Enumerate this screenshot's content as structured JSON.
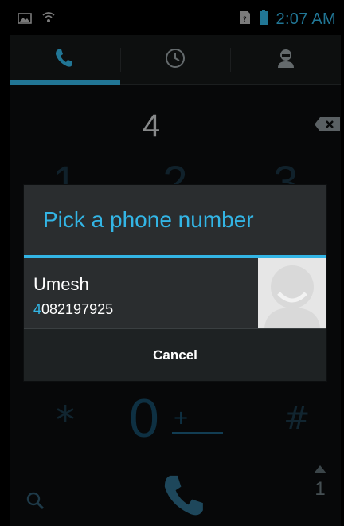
{
  "status_bar": {
    "time": "2:07 AM",
    "icons": [
      "image-notification-icon",
      "wifi-icon",
      "sim-icon",
      "battery-icon"
    ]
  },
  "tabs": [
    {
      "name": "phone",
      "icon": "phone-icon",
      "active": true
    },
    {
      "name": "recent",
      "icon": "clock-icon",
      "active": false
    },
    {
      "name": "contacts",
      "icon": "person-icon",
      "active": false
    }
  ],
  "dialer": {
    "typed_digits": "4",
    "keypad_top_row": [
      "1",
      "2",
      "3"
    ],
    "key_star": "*",
    "key_zero": "0",
    "key_zero_sub": "+",
    "key_hash": "#",
    "overflow_count": "1"
  },
  "dialog": {
    "title": "Pick a phone number",
    "contact": {
      "name": "Umesh",
      "number_highlight": "4",
      "number_rest": "082197925"
    },
    "cancel_label": "Cancel"
  },
  "colors": {
    "accent": "#33b5e5",
    "background": "#0b0d0e",
    "dialog_bg": "#2a2d2f"
  }
}
